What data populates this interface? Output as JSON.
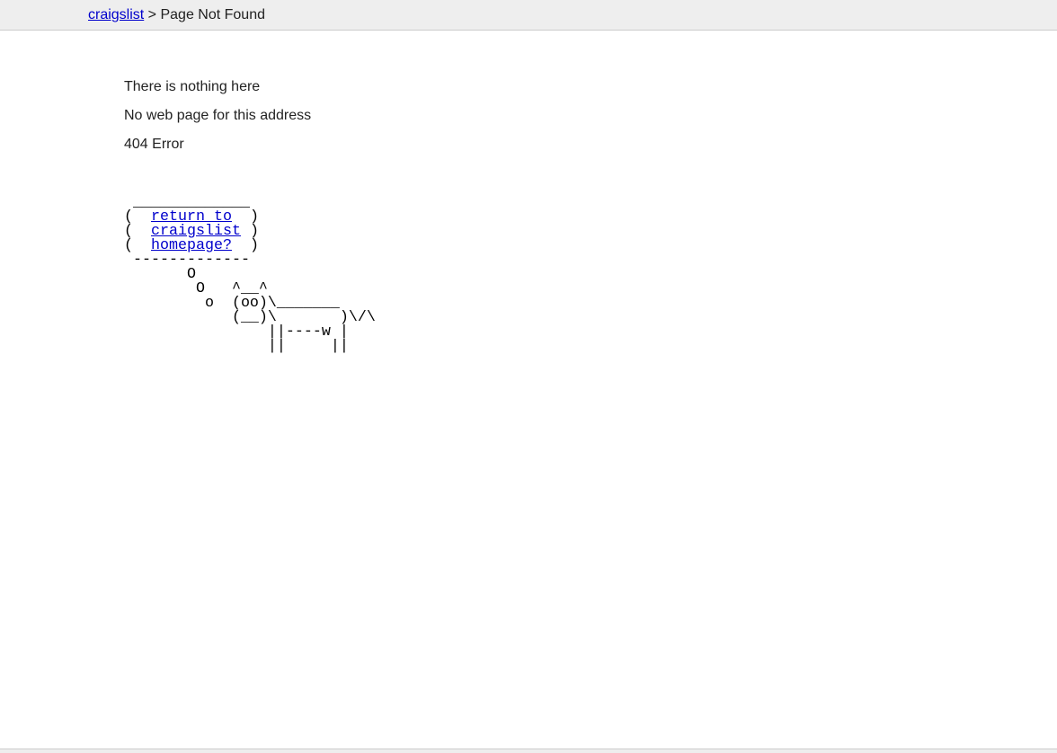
{
  "header": {
    "home_link": "craigslist",
    "separator": " > ",
    "page_title": "Page Not Found"
  },
  "messages": {
    "line1": "There is nothing here",
    "line2": "No web page for this address",
    "line3": "404 Error"
  },
  "cow_art": {
    "top_border": " _____________",
    "bubble_l1_prefix": "(  ",
    "bubble_l1_link": "return to",
    "bubble_l1_suffix": "  )",
    "bubble_l2_prefix": "(  ",
    "bubble_l2_link": "craigslist",
    "bubble_l2_suffix": " )",
    "bubble_l3_prefix": "(  ",
    "bubble_l3_link": "homepage?",
    "bubble_l3_suffix": "  )",
    "bottom_border": " -------------",
    "body": "       O\n        O   ^__^\n         o  (oo)\\_______\n            (__)\\       )\\/\\\n                ||----w |\n                ||     ||"
  }
}
